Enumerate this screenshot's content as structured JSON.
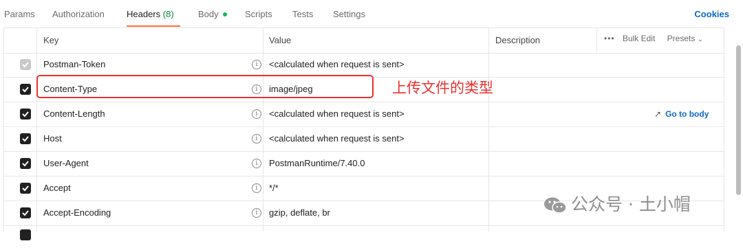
{
  "tabs": {
    "params": "Params",
    "authorization": "Authorization",
    "headers": "Headers",
    "headers_count": "(8)",
    "body": "Body",
    "scripts": "Scripts",
    "tests": "Tests",
    "settings": "Settings",
    "cookies": "Cookies"
  },
  "table": {
    "col_key": "Key",
    "col_value": "Value",
    "col_description": "Description",
    "more_icon": "ellipsis-icon",
    "bulk_edit": "Bulk Edit",
    "presets": "Presets",
    "rows": [
      {
        "key": "Postman-Token",
        "value": "<calculated when request is sent>",
        "checked": true,
        "disabled": true
      },
      {
        "key": "Content-Type",
        "value": "image/jpeg",
        "checked": true,
        "disabled": false
      },
      {
        "key": "Content-Length",
        "value": "<calculated when request is sent>",
        "checked": true,
        "disabled": false,
        "link": "Go to body"
      },
      {
        "key": "Host",
        "value": "<calculated when request is sent>",
        "checked": true,
        "disabled": false
      },
      {
        "key": "User-Agent",
        "value": "PostmanRuntime/7.40.0",
        "checked": true,
        "disabled": false
      },
      {
        "key": "Accept",
        "value": "*/*",
        "checked": true,
        "disabled": false
      },
      {
        "key": "Accept-Encoding",
        "value": "gzip, deflate, br",
        "checked": true,
        "disabled": false
      }
    ]
  },
  "annotation": "上传文件的类型",
  "watermark": "公众号 · 土小帽",
  "colors": {
    "accent": "#ff6c37",
    "link": "#0b68c9",
    "annotation": "#e8312f",
    "body_dot": "#0cbb52"
  }
}
